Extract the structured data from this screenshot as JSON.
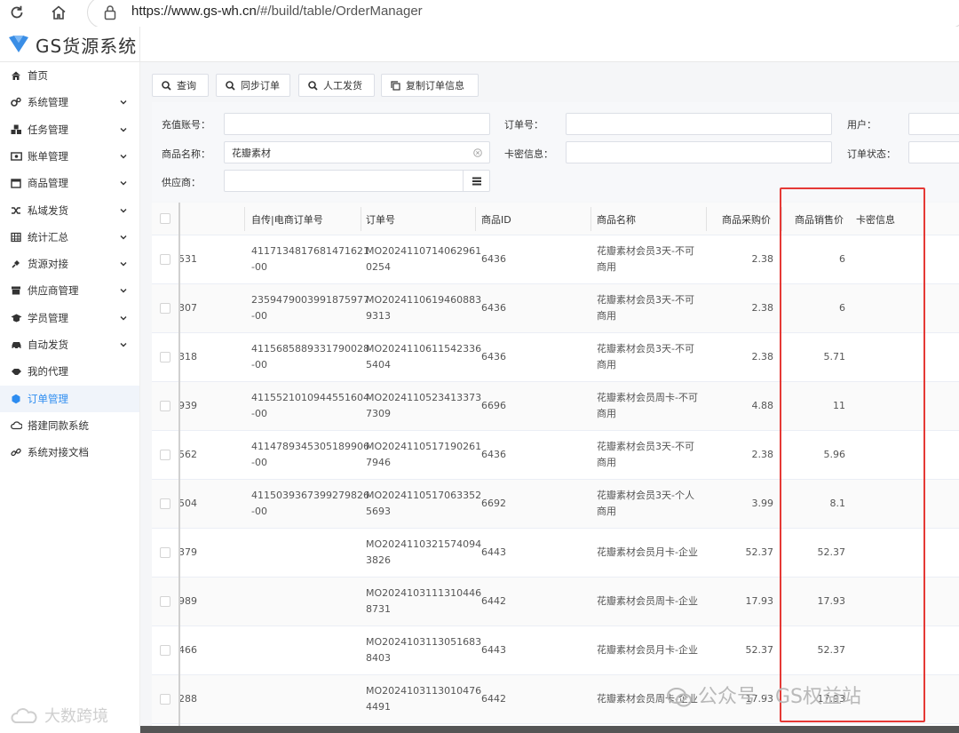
{
  "browser": {
    "url_host": "https://www.gs-wh.cn",
    "url_path": "/#/build/table/OrderManager"
  },
  "app": {
    "title": "GS货源系统"
  },
  "sidebar": {
    "items": [
      {
        "label": "首页",
        "icon": "home-icon",
        "chevron": false,
        "active": false
      },
      {
        "label": "系统管理",
        "icon": "gears-icon",
        "chevron": true,
        "active": false
      },
      {
        "label": "任务管理",
        "icon": "cubes-icon",
        "chevron": true,
        "active": false
      },
      {
        "label": "账单管理",
        "icon": "money-bill-icon",
        "chevron": true,
        "active": false
      },
      {
        "label": "商品管理",
        "icon": "calendar-icon",
        "chevron": true,
        "active": false
      },
      {
        "label": "私域发货",
        "icon": "shuffle-icon",
        "chevron": true,
        "active": false
      },
      {
        "label": "统计汇总",
        "icon": "table-icon",
        "chevron": true,
        "active": false
      },
      {
        "label": "货源对接",
        "icon": "plug-icon",
        "chevron": true,
        "active": false
      },
      {
        "label": "供应商管理",
        "icon": "archive-icon",
        "chevron": true,
        "active": false
      },
      {
        "label": "学员管理",
        "icon": "graduation-icon",
        "chevron": true,
        "active": false
      },
      {
        "label": "自动发货",
        "icon": "car-icon",
        "chevron": true,
        "active": false
      },
      {
        "label": "我的代理",
        "icon": "handshake-icon",
        "chevron": false,
        "active": false
      },
      {
        "label": "订单管理",
        "icon": "dot-circle-icon",
        "chevron": false,
        "active": true
      },
      {
        "label": "搭建同款系统",
        "icon": "cloud-icon",
        "chevron": false,
        "active": false
      },
      {
        "label": "系统对接文档",
        "icon": "link-icon",
        "chevron": false,
        "active": false
      }
    ]
  },
  "toolbar": {
    "query": "查询",
    "sync": "同步订单",
    "manual": "人工发货",
    "copy": "复制订单信息"
  },
  "filters": {
    "recharge_account": "充值账号：",
    "order_no": "订单号：",
    "user": "用户：",
    "product_name": "商品名称：",
    "product_name_value": "花瓣素材",
    "card_info": "卡密信息：",
    "order_status": "订单状态：",
    "supplier": "供应商："
  },
  "table": {
    "headers": {
      "ext_order": "自传|电商订单号",
      "order_no": "订单号",
      "product_id": "商品ID",
      "product_name": "商品名称",
      "purchase_price": "商品采购价",
      "sale_price": "商品销售价",
      "card_info": "卡密信息"
    },
    "rows": [
      {
        "cut": "531",
        "ext1": "4117134817681471621",
        "ext2": "-00",
        "ord1": "MO2024110714062961",
        "ord2": "0254",
        "pid": "6436",
        "name1": "花瓣素材会员3天-不可",
        "name2": "商用",
        "buy": "2.38",
        "sell": "6"
      },
      {
        "cut": "307",
        "ext1": "2359479003991875977",
        "ext2": "-00",
        "ord1": "MO2024110619460883",
        "ord2": "9313",
        "pid": "6436",
        "name1": "花瓣素材会员3天-不可",
        "name2": "商用",
        "buy": "2.38",
        "sell": "6"
      },
      {
        "cut": "318",
        "ext1": "4115685889331790028",
        "ext2": "-00",
        "ord1": "MO2024110611542336",
        "ord2": "5404",
        "pid": "6436",
        "name1": "花瓣素材会员3天-不可",
        "name2": "商用",
        "buy": "2.38",
        "sell": "5.71"
      },
      {
        "cut": "939",
        "ext1": "4115521010944551604",
        "ext2": "-00",
        "ord1": "MO2024110523413373",
        "ord2": "7309",
        "pid": "6696",
        "name1": "花瓣素材会员周卡-不可",
        "name2": "商用",
        "buy": "4.88",
        "sell": "11"
      },
      {
        "cut": "562",
        "ext1": "4114789345305189906",
        "ext2": "-00",
        "ord1": "MO2024110517190261",
        "ord2": "7946",
        "pid": "6436",
        "name1": "花瓣素材会员3天-不可",
        "name2": "商用",
        "buy": "2.38",
        "sell": "5.96"
      },
      {
        "cut": "504",
        "ext1": "4115039367399279826",
        "ext2": "-00",
        "ord1": "MO2024110517063352",
        "ord2": "5693",
        "pid": "6692",
        "name1": "花瓣素材会员3天-个人",
        "name2": "商用",
        "buy": "3.99",
        "sell": "8.1"
      },
      {
        "cut": "379",
        "ext1": "",
        "ext2": "",
        "ord1": "MO2024110321574094",
        "ord2": "3826",
        "pid": "6443",
        "name1": "花瓣素材会员月卡-企业",
        "name2": "",
        "buy": "52.37",
        "sell": "52.37"
      },
      {
        "cut": "989",
        "ext1": "",
        "ext2": "",
        "ord1": "MO2024103111310446",
        "ord2": "8731",
        "pid": "6442",
        "name1": "花瓣素材会员周卡-企业",
        "name2": "",
        "buy": "17.93",
        "sell": "17.93"
      },
      {
        "cut": "466",
        "ext1": "",
        "ext2": "",
        "ord1": "MO2024103113051683",
        "ord2": "8403",
        "pid": "6443",
        "name1": "花瓣素材会员月卡-企业",
        "name2": "",
        "buy": "52.37",
        "sell": "52.37"
      },
      {
        "cut": "288",
        "ext1": "",
        "ext2": "",
        "ord1": "MO2024103113010476",
        "ord2": "4491",
        "pid": "6442",
        "name1": "花瓣素材会员周卡-企业",
        "name2": "",
        "buy": "17.93",
        "sell": "17.93"
      }
    ]
  },
  "watermarks": {
    "wechat": "公众号 · GS权益站",
    "corner": "大数跨境"
  },
  "colors": {
    "accent": "#2d8cf0",
    "highlight_box": "#e53935"
  }
}
